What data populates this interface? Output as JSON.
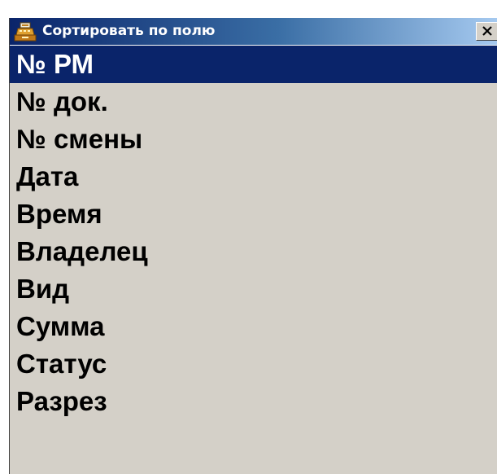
{
  "window": {
    "title": "Сортировать по полю",
    "close_glyph": "X",
    "app_icon": "cash-register-icon"
  },
  "sort_fields": {
    "selected_index": 0,
    "items": [
      "№ РМ",
      "№ док.",
      "№ смены",
      "Дата",
      "Время",
      "Владелец",
      "Вид",
      "Сумма",
      "Статус",
      "Разрез"
    ]
  },
  "colors": {
    "selection_background": "#0a246a",
    "window_background": "#d4d0c8",
    "title_gradient_start": "#0a246a",
    "title_gradient_end": "#a6caf0"
  }
}
